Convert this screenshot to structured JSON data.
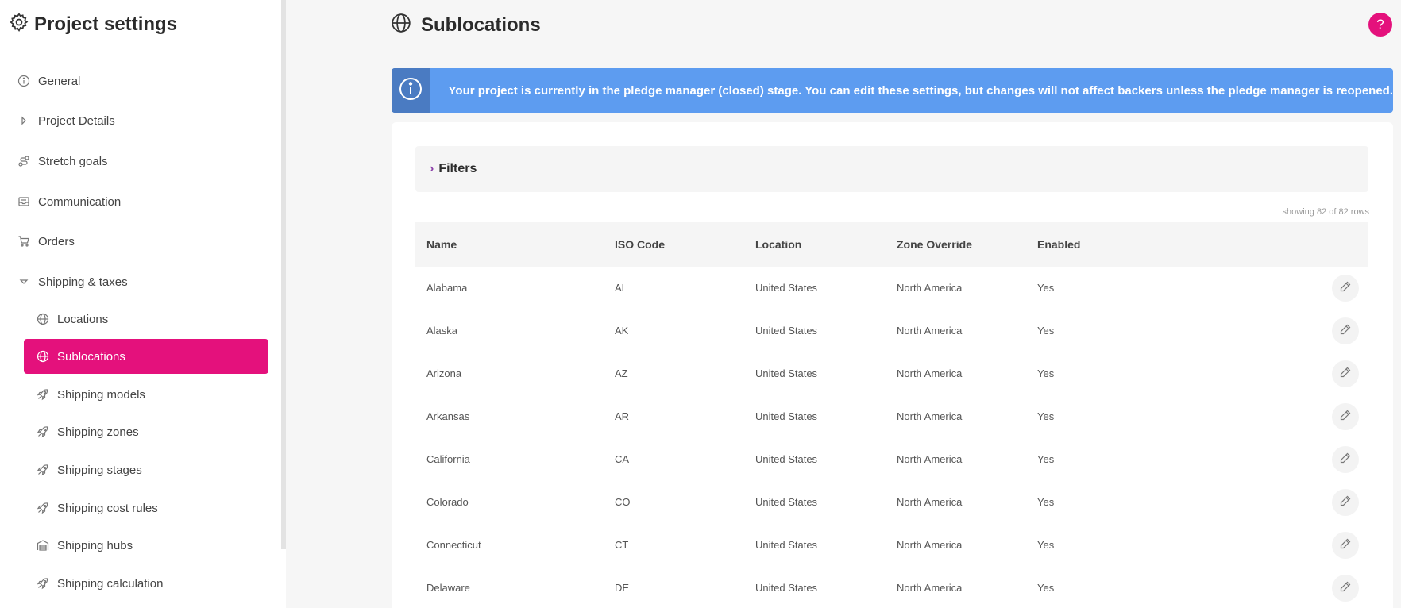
{
  "sidebar": {
    "title": "Project settings",
    "items": [
      {
        "label": "General",
        "icon": "info-icon"
      },
      {
        "label": "Project Details",
        "icon": "caret-right-icon"
      },
      {
        "label": "Stretch goals",
        "icon": "route-icon"
      },
      {
        "label": "Communication",
        "icon": "inbox-icon"
      },
      {
        "label": "Orders",
        "icon": "cart-icon"
      },
      {
        "label": "Shipping & taxes",
        "icon": "caret-down-icon"
      }
    ],
    "sub_items": [
      {
        "label": "Locations",
        "icon": "globe-icon",
        "active": false
      },
      {
        "label": "Sublocations",
        "icon": "globe-icon",
        "active": true
      },
      {
        "label": "Shipping models",
        "icon": "rocket-icon",
        "active": false
      },
      {
        "label": "Shipping zones",
        "icon": "rocket-icon",
        "active": false
      },
      {
        "label": "Shipping stages",
        "icon": "rocket-icon",
        "active": false
      },
      {
        "label": "Shipping cost rules",
        "icon": "rocket-icon",
        "active": false
      },
      {
        "label": "Shipping hubs",
        "icon": "warehouse-icon",
        "active": false
      },
      {
        "label": "Shipping calculation",
        "icon": "rocket-icon",
        "active": false
      }
    ]
  },
  "header": {
    "title": "Sublocations",
    "help": "?"
  },
  "banner": {
    "text": "Your project is currently in the pledge manager (closed) stage. You can edit these settings, but changes will not affect backers unless the pledge manager is reopened."
  },
  "filters": {
    "label": "Filters"
  },
  "table": {
    "row_count": "showing 82 of 82 rows",
    "columns": [
      "Name",
      "ISO Code",
      "Location",
      "Zone Override",
      "Enabled"
    ],
    "rows": [
      [
        "Alabama",
        "AL",
        "United States",
        "North America",
        "Yes"
      ],
      [
        "Alaska",
        "AK",
        "United States",
        "North America",
        "Yes"
      ],
      [
        "Arizona",
        "AZ",
        "United States",
        "North America",
        "Yes"
      ],
      [
        "Arkansas",
        "AR",
        "United States",
        "North America",
        "Yes"
      ],
      [
        "California",
        "CA",
        "United States",
        "North America",
        "Yes"
      ],
      [
        "Colorado",
        "CO",
        "United States",
        "North America",
        "Yes"
      ],
      [
        "Connecticut",
        "CT",
        "United States",
        "North America",
        "Yes"
      ],
      [
        "Delaware",
        "DE",
        "United States",
        "North America",
        "Yes"
      ]
    ]
  },
  "colors": {
    "accent": "#e4117c",
    "banner": "#5d9cf0",
    "banner_icon_bg": "#4a7bc2"
  }
}
